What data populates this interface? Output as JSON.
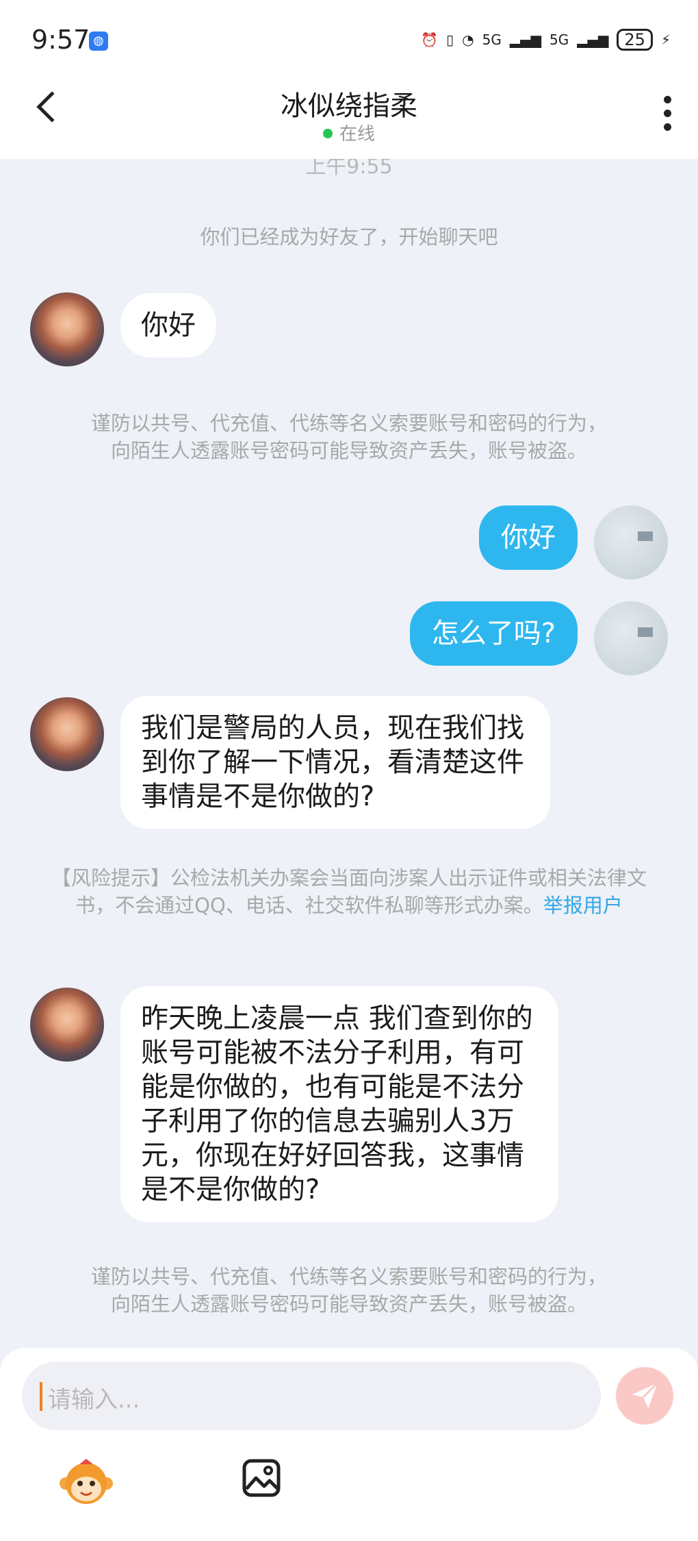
{
  "status_bar": {
    "time": "9:57",
    "app_icon": "browser-icon",
    "network_1": "5G",
    "network_2": "5G",
    "battery": "25"
  },
  "header": {
    "title": "冰似绕指柔",
    "status": "在线"
  },
  "chat": {
    "time_partial": "上午9:55",
    "friend_notice": "你们已经成为好友了，开始聊天吧",
    "messages": [
      {
        "side": "left",
        "text": "你好"
      },
      {
        "side": "right",
        "text": "你好"
      },
      {
        "side": "right",
        "text": "怎么了吗?"
      },
      {
        "side": "left",
        "text": "我们是警局的人员，现在我们找到你了解一下情况，看清楚这件事情是不是你做的?"
      },
      {
        "side": "left",
        "text": "昨天晚上凌晨一点 我们查到你的账号可能被不法分子利用，有可能是你做的，也有可能是不法分子利用了你的信息去骗别人3万元，你现在好好回答我，这事情是不是你做的?"
      }
    ],
    "warning_1_line1": "谨防以共号、代充值、代练等名义索要账号和密码的行为，",
    "warning_1_line2": "向陌生人透露账号密码可能导致资产丢失，账号被盗。",
    "risk_text": "【风险提示】公检法机关办案会当面向涉案人出示证件或相关法律文书，不会通过QQ、电话、社交软件私聊等形式办案。",
    "report_link": "举报用户",
    "warning_2_line1": "谨防以共号、代充值、代练等名义索要账号和密码的行为，",
    "warning_2_line2": "向陌生人透露账号密码可能导致资产丢失，账号被盗。"
  },
  "input": {
    "placeholder": "请输入..."
  },
  "colors": {
    "accent": "#2eb7ef",
    "background": "#eef1f7",
    "link": "#33a6e8",
    "online": "#27c651",
    "send_disabled": "#fbc9c5"
  }
}
